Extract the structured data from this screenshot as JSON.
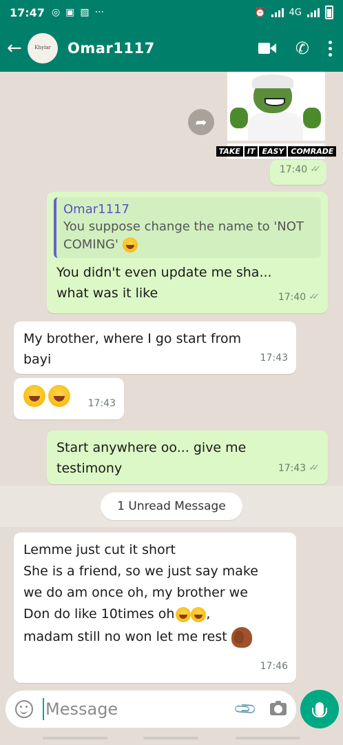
{
  "status_bar": {
    "time": "17:47",
    "network": "4G",
    "more": "···"
  },
  "header": {
    "contact_name": "Omar1117",
    "avatar_text": "Khylar"
  },
  "messages": {
    "image_msg": {
      "caption": [
        "TAKE",
        "IT",
        "EASY",
        "COMRADE"
      ],
      "time": "17:40"
    },
    "reply_msg": {
      "quote_name": "Omar1117",
      "quote_text": "You suppose change the name to 'NOT COMING'",
      "text": "You didn't even update me sha... what was it like",
      "time": "17:40"
    },
    "in_1": {
      "text": "My brother, where I go start from bayi",
      "time": "17:43"
    },
    "in_2": {
      "time": "17:43"
    },
    "out_3": {
      "text": "Start anywhere oo... give me testimony",
      "time": "17:43"
    },
    "unread_label": "1 Unread Message",
    "in_4": {
      "line1": "Lemme just cut it short",
      "line2": "She is a friend, so we just say make",
      "line3": "we do am once oh, my brother we",
      "line4": "Don do like 10times oh",
      "line4_end": ",",
      "line5": "madam still no won let me rest",
      "time": "17:46"
    }
  },
  "input": {
    "placeholder": "Message"
  },
  "colors": {
    "header": "#00806a",
    "outgoing": "#dcf8c6",
    "incoming": "#ffffff",
    "accent": "#00a884"
  },
  "icons": [
    "back-arrow-icon",
    "video-call-icon",
    "phone-icon",
    "more-icon",
    "forward-icon",
    "emoji-icon",
    "attach-icon",
    "camera-icon",
    "mic-icon"
  ]
}
